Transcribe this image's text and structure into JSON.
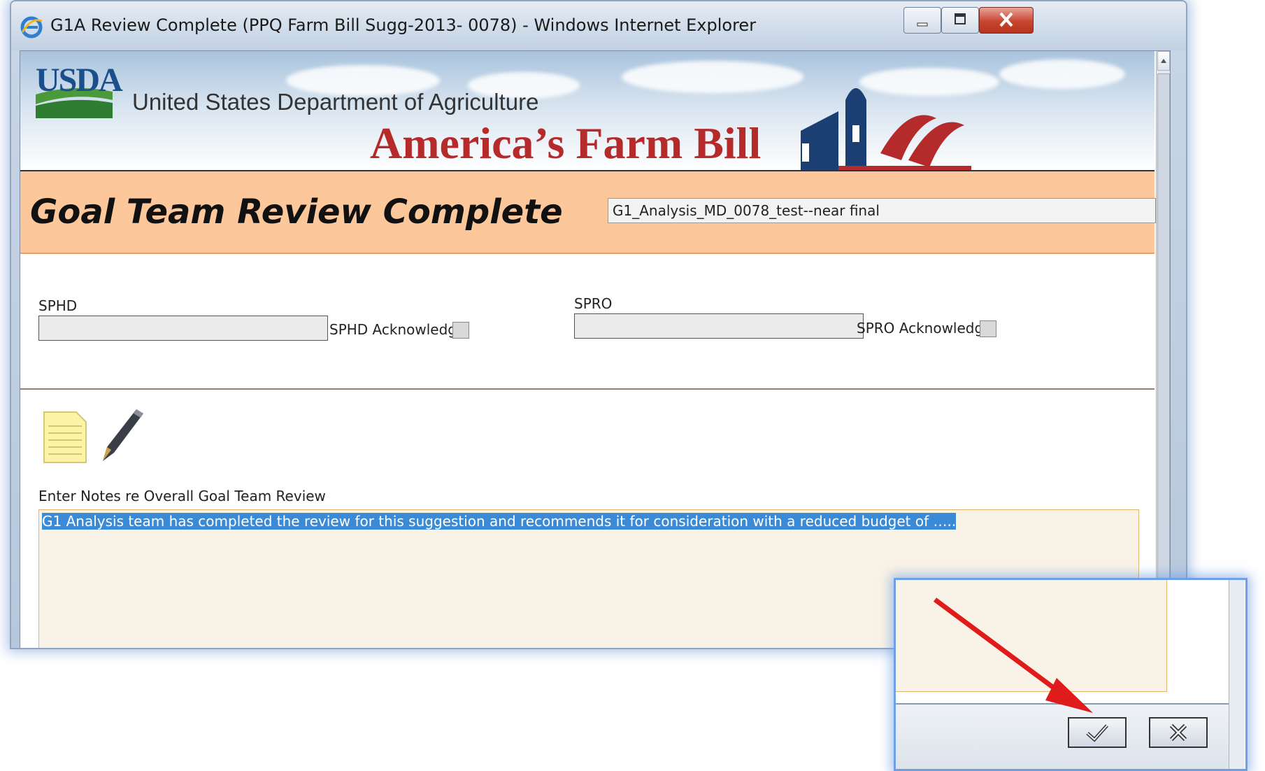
{
  "window": {
    "title": "G1A Review Complete (PPQ Farm Bill Sugg-2013- 0078) - Windows Internet Explorer"
  },
  "banner": {
    "agency_short": "USDA",
    "agency_name": "United States Department of Agriculture",
    "program_name": "America’s Farm Bill"
  },
  "header": {
    "page_title": "Goal Team Review Complete",
    "record_name": "G1_Analysis_MD_0078_test--near final"
  },
  "reviewers": {
    "sphd_label": "SPHD",
    "sphd_value": "",
    "sphd_ack_label": "SPHD Acknowledge",
    "spro_label": "SPRO",
    "spro_value": "",
    "spro_ack_label": "SPRO Acknowledge"
  },
  "notes": {
    "label": "Enter Notes re Overall Goal Team Review",
    "text": "G1 Analysis team has completed the review for this suggestion and recommends it for consideration with a reduced budget of ….."
  },
  "icons": {
    "notepad": "notepad-icon",
    "pen": "pen-icon",
    "confirm": "checkmark-icon",
    "cancel": "close-icon"
  },
  "colors": {
    "header_band": "#fbc79b",
    "selection": "#3b8ad6",
    "arrow": "#e01b1b",
    "inset_border": "#6f9fe4"
  }
}
